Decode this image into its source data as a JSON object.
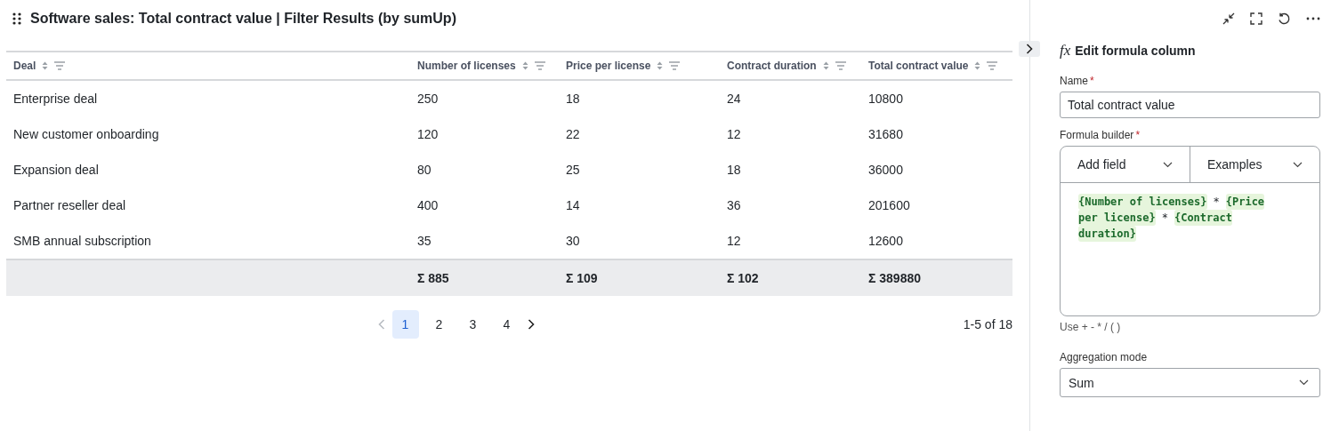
{
  "header": {
    "title": "Software sales: Total contract value | Filter Results (by sumUp)"
  },
  "table": {
    "columns": [
      {
        "label": "Deal"
      },
      {
        "label": "Number of licenses"
      },
      {
        "label": "Price per license"
      },
      {
        "label": "Contract duration"
      },
      {
        "label": "Total contract value"
      }
    ],
    "rows": [
      [
        "Enterprise deal",
        "250",
        "18",
        "24",
        "10800"
      ],
      [
        "New customer onboarding",
        "120",
        "22",
        "12",
        "31680"
      ],
      [
        "Expansion deal",
        "80",
        "25",
        "18",
        "36000"
      ],
      [
        "Partner reseller deal",
        "400",
        "14",
        "36",
        "201600"
      ],
      [
        "SMB annual subscription",
        "35",
        "30",
        "12",
        "12600"
      ]
    ],
    "totals": [
      "Σ 885",
      "Σ 109",
      "Σ 102",
      "Σ 389880"
    ]
  },
  "pagination": {
    "prev_disabled": true,
    "next_disabled": false,
    "pages": [
      {
        "label": "1",
        "selected": true
      },
      {
        "label": "2",
        "selected": false
      },
      {
        "label": "3",
        "selected": false
      },
      {
        "label": "4",
        "selected": false
      }
    ],
    "range": "1-5 of 18"
  },
  "panel": {
    "icon_text": "fx",
    "title": "Edit formula column",
    "name_field": {
      "label": "Name",
      "required_mark": "*",
      "value": "Total contract value"
    },
    "formula": {
      "label": "Formula builder",
      "required_mark": "*",
      "dropdowns": [
        "Add field",
        "Examples"
      ],
      "tokens": [
        {
          "kind": "field",
          "text": "{Number of licenses}"
        },
        {
          "kind": "op",
          "text": "*"
        },
        {
          "kind": "field",
          "text": "{Price"
        },
        {
          "kind": "field",
          "text": "per license}"
        },
        {
          "kind": "op",
          "text": "*"
        },
        {
          "kind": "field",
          "text": "{Contract"
        },
        {
          "kind": "field",
          "text": "duration}"
        }
      ],
      "hint": "Use + - * / ( )"
    },
    "aggregation": {
      "label": "Aggregation mode",
      "value": "Sum"
    }
  }
}
